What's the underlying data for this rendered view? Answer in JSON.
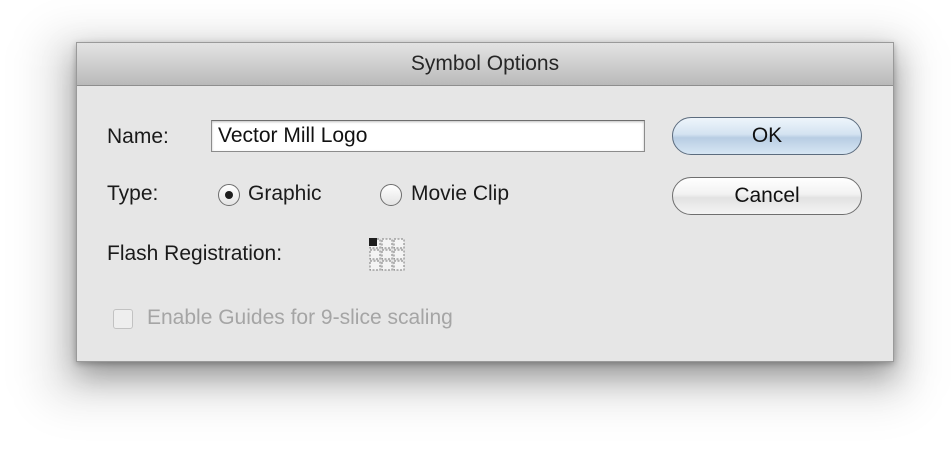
{
  "dialog": {
    "title": "Symbol Options"
  },
  "name_field": {
    "label": "Name:",
    "value": "Vector Mill Logo"
  },
  "type": {
    "label": "Type:",
    "options": [
      {
        "label": "Graphic",
        "selected": true
      },
      {
        "label": "Movie Clip",
        "selected": false
      }
    ]
  },
  "registration": {
    "label": "Flash Registration:",
    "selected_point": "top-left"
  },
  "guides_checkbox": {
    "label": "Enable Guides for 9-slice scaling",
    "checked": false,
    "enabled": false
  },
  "buttons": {
    "ok_label": "OK",
    "cancel_label": "Cancel"
  },
  "icons": {
    "registration_grid": "registration-grid-icon"
  }
}
